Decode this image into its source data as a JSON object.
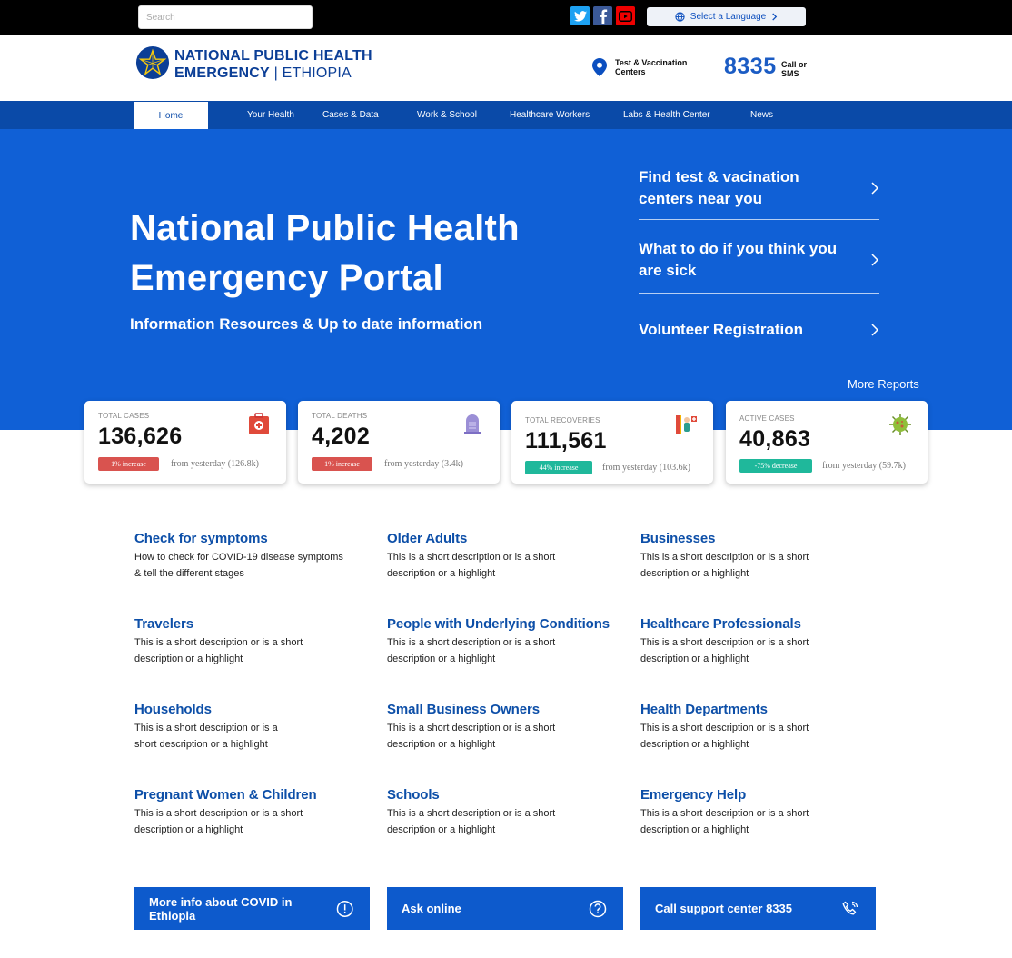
{
  "topbar": {
    "search_placeholder": "Search",
    "social": [
      "twitter-icon",
      "facebook-icon",
      "youtube-icon"
    ],
    "language_label": "Select a Language"
  },
  "header": {
    "brand_line1": "NATIONAL PUBLIC HEALTH",
    "brand_line2_bold": "EMERGENCY",
    "brand_line2_sep": " | ",
    "brand_line2_light": "ETHIOPIA",
    "test_centers_label": "Test & Vaccination Centers",
    "call_number": "8335",
    "call_text": "Call or SMS"
  },
  "nav": {
    "items": [
      "Home",
      "Your Health",
      "Cases & Data",
      "Work & School",
      "Healthcare Workers",
      "Labs & Health Center",
      "News"
    ],
    "active": "Home"
  },
  "hero": {
    "title_line1": "National Public Health",
    "title_line2": "Emergency Portal",
    "subtitle": "Information Resources & Up to date information",
    "links": [
      "Find test & vacination centers near you",
      "What to do if you think you are sick",
      "Volunteer Registration"
    ],
    "more_reports": "More Reports"
  },
  "stats": [
    {
      "label": "TOTAL CASES",
      "value": "136,626",
      "badge": "1% increase",
      "badge_color": "#d9534f",
      "from": "from yesterday (126.8k)"
    },
    {
      "label": "TOTAL DEATHS",
      "value": "4,202",
      "badge": "1% increase",
      "badge_color": "#d9534f",
      "from": "from yesterday (3.4k)"
    },
    {
      "label": "TOTAL RECOVERIES",
      "value": "111,561",
      "badge": "44% increase",
      "badge_color": "#1fb89b",
      "from": "from yesterday (103.6k)"
    },
    {
      "label": "ACTIVE CASES",
      "value": "40,863",
      "badge": "-75% decrease",
      "badge_color": "#1fb89b",
      "from": "from yesterday (59.7k)"
    }
  ],
  "topics": [
    {
      "title": "Check for symptoms",
      "desc": "How to check for COVID-19 disease symptoms & tell the different stages"
    },
    {
      "title": "Older Adults",
      "desc": "This is a short description or is a short description or a highlight"
    },
    {
      "title": "Businesses",
      "desc": "This is a short description or is a short description or a highlight"
    },
    {
      "title": "Travelers",
      "desc": "This is a short description or is a short description or a highlight"
    },
    {
      "title": "People with Underlying Conditions",
      "desc": "This is a short description or is a short description or a highlight"
    },
    {
      "title": "Healthcare Professionals",
      "desc": "This is a short description or is a short description or a highlight"
    },
    {
      "title": "Households",
      "desc": "This is a short description or is a short description or a highlight"
    },
    {
      "title": "Small Business Owners",
      "desc": "This is a short description or is a short description or a highlight"
    },
    {
      "title": "Health Departments",
      "desc": "This is a short description or is a short description or a highlight"
    },
    {
      "title": "Pregnant Women & Children",
      "desc": "This is a short description or is a short description or a highlight"
    },
    {
      "title": "Schools",
      "desc": "This is a short description or is a short description or a highlight"
    },
    {
      "title": "Emergency Help",
      "desc": "This is a short description or is a short description or a highlight"
    }
  ],
  "ctas": [
    {
      "label": "More info about COVID in Ethiopia",
      "icon": "info-icon"
    },
    {
      "label": "Ask online",
      "icon": "question-icon"
    },
    {
      "label": "Call support center 8335",
      "icon": "phone-icon"
    }
  ],
  "colors": {
    "primary": "#1060d6",
    "nav": "#0a4aa8",
    "brand": "#0b3e96"
  }
}
